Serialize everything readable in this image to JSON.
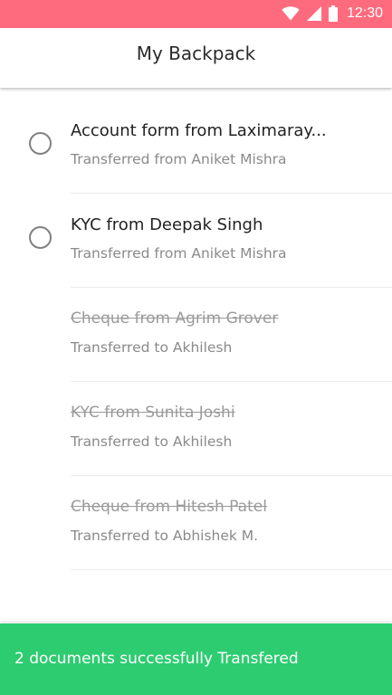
{
  "status_bar": {
    "time": "12:30",
    "icons": [
      "wifi-icon",
      "signal-icon",
      "battery-icon"
    ],
    "color": "#ff6b7e"
  },
  "app_bar": {
    "title": "My Backpack"
  },
  "documents": [
    {
      "title": "Account form from Laximaray...",
      "subtitle": "Transferred from Aniket Mishra",
      "selectable": true,
      "transferred": false
    },
    {
      "title": "KYC from Deepak Singh",
      "subtitle": "Transferred from Aniket Mishra",
      "selectable": true,
      "transferred": false
    },
    {
      "title": "Cheque from Agrim Grover",
      "subtitle": "Transferred to Akhilesh",
      "selectable": false,
      "transferred": true
    },
    {
      "title": "KYC from Sunita Joshi",
      "subtitle": "Transferred to Akhilesh",
      "selectable": false,
      "transferred": true
    },
    {
      "title": "Cheque from Hitesh Patel",
      "subtitle": "Transferred to Abhishek M.",
      "selectable": false,
      "transferred": true
    }
  ],
  "snackbar": {
    "message": "2 documents successfully Transfered",
    "color": "#2ecc71"
  }
}
